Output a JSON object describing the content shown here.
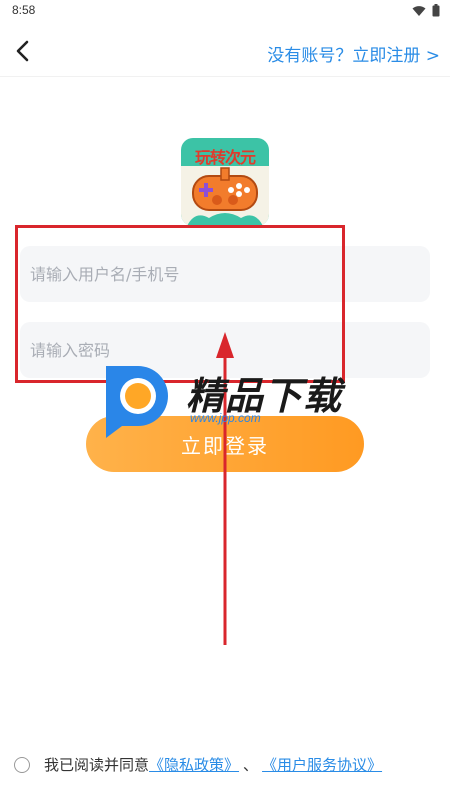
{
  "status_bar": {
    "time": "8:58"
  },
  "header": {
    "register_link": "没有账号？立即注册 >"
  },
  "logo": {
    "title": "玩转次元"
  },
  "form": {
    "username_placeholder": "请输入用户名/手机号",
    "password_placeholder": "请输入密码",
    "login_label": "立即登录"
  },
  "watermark": {
    "text": "精品下载",
    "url": "www.jpp.com"
  },
  "agreement": {
    "prefix": "我已阅读并同意",
    "privacy": "《隐私政策》",
    "separator": "、",
    "service": "《用户服务协议》"
  },
  "colors": {
    "accent": "#2a8ce6",
    "button": "#ff9f2a",
    "annotation": "#d9262c"
  }
}
